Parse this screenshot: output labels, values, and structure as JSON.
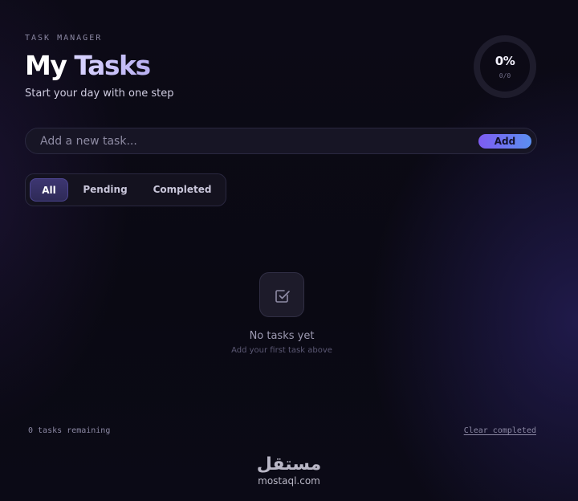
{
  "header": {
    "eyebrow": "TASK MANAGER",
    "title_word1": "My",
    "title_word2": "Tasks",
    "subtitle": "Start your day with one step"
  },
  "progress": {
    "percent_label": "0%",
    "count_label": "0/0",
    "fraction": 0
  },
  "add_task": {
    "placeholder": "Add a new task...",
    "value": "",
    "button_label": "Add"
  },
  "filters": {
    "tabs": [
      {
        "label": "All",
        "active": true
      },
      {
        "label": "Pending",
        "active": false
      },
      {
        "label": "Completed",
        "active": false
      }
    ]
  },
  "empty_state": {
    "icon": "checkbox-icon",
    "title": "No tasks yet",
    "subtitle": "Add your first task above"
  },
  "footer": {
    "remaining": "0 tasks remaining",
    "clear_label": "Clear completed"
  },
  "watermark": {
    "arabic": "مستقل",
    "latin": "mostaql.com"
  },
  "colors": {
    "background": "#0b0914",
    "accent_start": "#7e5cf2",
    "accent_end": "#5b8ff0",
    "active_tab": "#3d3672"
  }
}
